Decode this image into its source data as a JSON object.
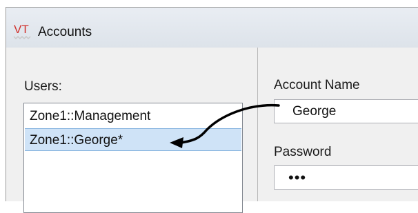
{
  "window": {
    "title": "Accounts",
    "logo_text": "VT",
    "accent_color": "#d0322d"
  },
  "users_panel": {
    "label": "Users:",
    "items": [
      {
        "label": "Zone1::Management",
        "selected": false
      },
      {
        "label": "Zone1::George*",
        "selected": true
      }
    ]
  },
  "account_panel": {
    "account_name_label": "Account Name",
    "account_name_value": "George",
    "password_label": "Password",
    "password_value": "•••"
  },
  "annotation": {
    "arrow_color": "#000000",
    "from": "account-name-field",
    "to": "user-list-item-george"
  }
}
